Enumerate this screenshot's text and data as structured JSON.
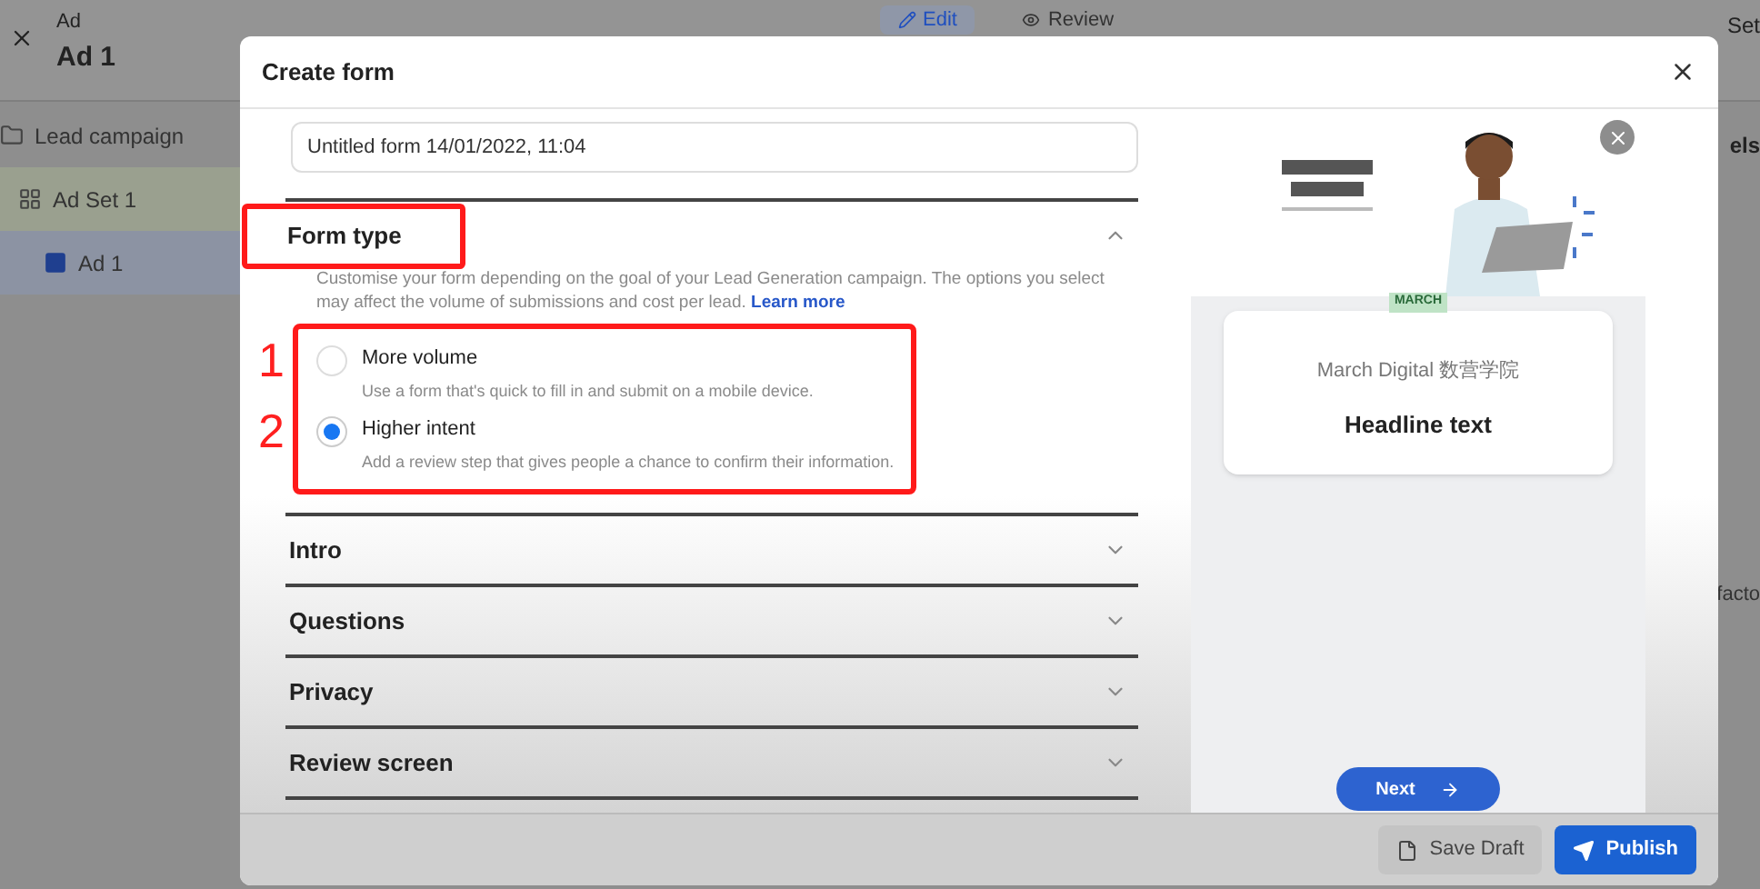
{
  "background_app": {
    "header": {
      "overline": "Ad",
      "title": "Ad 1"
    },
    "top_tabs": [
      {
        "label": "Edit",
        "selected": true
      },
      {
        "label": "Review",
        "selected": false
      }
    ],
    "top_right_button": "Set",
    "sidebar": {
      "items": [
        {
          "label": "Lead campaign",
          "kind": "campaign",
          "selected": false,
          "children": [
            {
              "label": "Ad Set 1",
              "kind": "adset",
              "selected": false,
              "children": [
                {
                  "label": "Ad 1",
                  "kind": "ad",
                  "selected": true
                }
              ]
            }
          ]
        }
      ]
    },
    "right_panel": {
      "heading": "els",
      "text": "facto"
    }
  },
  "dialog": {
    "title": "Create form",
    "form_name": {
      "value": "Untitled form 14/01/2022, 11:04"
    },
    "sections": [
      {
        "title": "Form type",
        "expanded": true,
        "highlighted": true,
        "description": "Customise your form depending on the goal of your Lead Generation campaign. The options you select may affect the volume of submissions and cost per lead.",
        "link": "Learn more",
        "options_highlighted": true,
        "options": [
          {
            "label": "More volume",
            "description": "Use a form that's quick to fill in and submit on a mobile device.",
            "selected": false,
            "annotation": "1"
          },
          {
            "label": "Higher intent",
            "description": "Add a review step that gives people a chance to confirm their information.",
            "selected": true,
            "annotation": "2"
          }
        ]
      },
      {
        "title": "Intro",
        "expanded": false
      },
      {
        "title": "Questions",
        "expanded": false
      },
      {
        "title": "Privacy",
        "expanded": false
      },
      {
        "title": "Review screen",
        "expanded": false
      }
    ],
    "preview": {
      "brand_tag": "MARCH",
      "page_name": "March Digital 数营学院",
      "headline": "Headline text",
      "next_button": "Next"
    },
    "footer_buttons": [
      {
        "label": "Save Draft",
        "kind": "secondary"
      },
      {
        "label": "Publish",
        "kind": "primary"
      }
    ]
  }
}
